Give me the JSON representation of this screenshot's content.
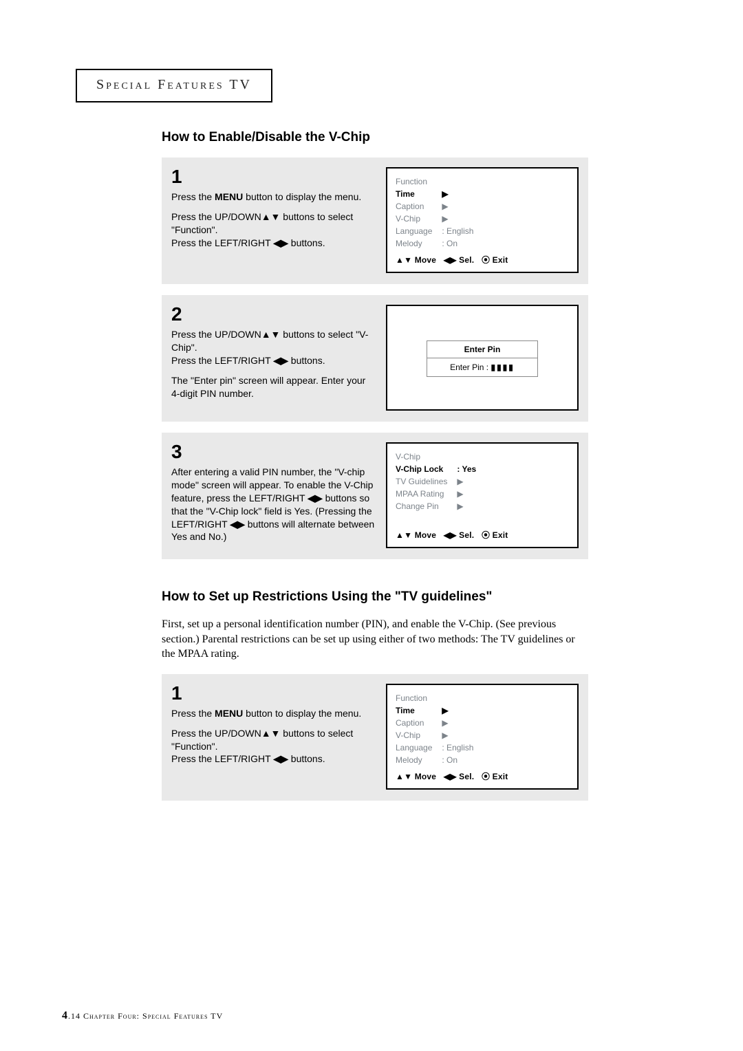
{
  "chapter": {
    "title_left": "Special",
    "title_mid": "Features",
    "title_right": "TV"
  },
  "section_a": {
    "heading": "How to Enable/Disable the V-Chip",
    "steps": [
      {
        "num": "1",
        "text_line1a": "Press the ",
        "text_line1_bold": "MENU",
        "text_line1b": " button to display the menu.",
        "text_line2a": "Press the UP/DOWN",
        "nav1": "▲▼",
        "text_line2b": " buttons to select \"Function\".",
        "text_line3a": "Press the LEFT/RIGHT ",
        "nav2": "◀▶",
        "text_line3b": " buttons.",
        "tv": {
          "heading": "Function",
          "rows": [
            {
              "l": "Time",
              "r": "▶",
              "hl": true
            },
            {
              "l": "Caption",
              "r": "▶"
            },
            {
              "l": "V-Chip",
              "r": "▶"
            },
            {
              "l": "Language",
              "r": ": English"
            },
            {
              "l": "Melody",
              "r": ": On"
            }
          ],
          "footer_move": "▲▼ Move",
          "footer_sel": "◀▶ Sel.",
          "footer_exit": "⦿ Exit"
        }
      },
      {
        "num": "2",
        "text_1a": "Press the UP/DOWN",
        "nav1": "▲▼",
        "text_1b": " buttons to select \"V-Chip\".",
        "text_2a": "Press the LEFT/RIGHT ",
        "nav2": "◀▶",
        "text_2b": " buttons.",
        "text_3": "The \"Enter pin\" screen will appear. Enter your 4-digit PIN number.",
        "tv": {
          "box_top": "Enter  Pin",
          "box_bot_label": "Enter  Pin : ",
          "pin_bars": "▮▮▮▮"
        }
      },
      {
        "num": "3",
        "text_a": "After entering a valid PIN number, the \"V-chip mode\" screen will appear. To enable the V-Chip feature, press the LEFT/RIGHT ",
        "nav1": "◀▶",
        "text_b": " buttons so that the \"V-Chip lock\" field is Yes. (Pressing the  LEFT/RIGHT ",
        "nav2": "◀▶",
        "text_c": " buttons will alternate between Yes and No.)",
        "tv": {
          "heading": "V-Chip",
          "rows": [
            {
              "l": "V-Chip Lock",
              "r": ": Yes",
              "hl": true
            },
            {
              "l": "TV Guidelines",
              "r": "▶"
            },
            {
              "l": "MPAA Rating",
              "r": "▶"
            },
            {
              "l": "Change Pin",
              "r": "▶"
            }
          ],
          "footer_move": "▲▼ Move",
          "footer_sel": "◀▶ Sel.",
          "footer_exit": "⦿ Exit"
        }
      }
    ]
  },
  "section_b": {
    "heading": "How to Set up Restrictions Using the \"TV guidelines\"",
    "intro": "First, set up a personal identification number (PIN), and enable the V-Chip. (See previous section.)  Parental restrictions can be set up using either of two methods: The TV guidelines or the MPAA rating.",
    "step": {
      "num": "1",
      "text_line1a": "Press the ",
      "text_line1_bold": "MENU",
      "text_line1b": " button to display the menu.",
      "text_line2a": "Press the UP/DOWN",
      "nav1": "▲▼",
      "text_line2b": " buttons to select \"Function\".",
      "text_line3a": "Press the LEFT/RIGHT ",
      "nav2": "◀▶",
      "text_line3b": " buttons.",
      "tv": {
        "heading": "Function",
        "rows": [
          {
            "l": "Time",
            "r": "▶",
            "hl": true
          },
          {
            "l": "Caption",
            "r": "▶"
          },
          {
            "l": "V-Chip",
            "r": "▶"
          },
          {
            "l": "Language",
            "r": ": English"
          },
          {
            "l": "Melody",
            "r": ": On"
          }
        ],
        "footer_move": "▲▼ Move",
        "footer_sel": "◀▶ Sel.",
        "footer_exit": "⦿ Exit"
      }
    }
  },
  "footer": {
    "page_main": "4",
    "page_sub": ".14",
    "label": " Chapter Four: Special Features TV"
  }
}
